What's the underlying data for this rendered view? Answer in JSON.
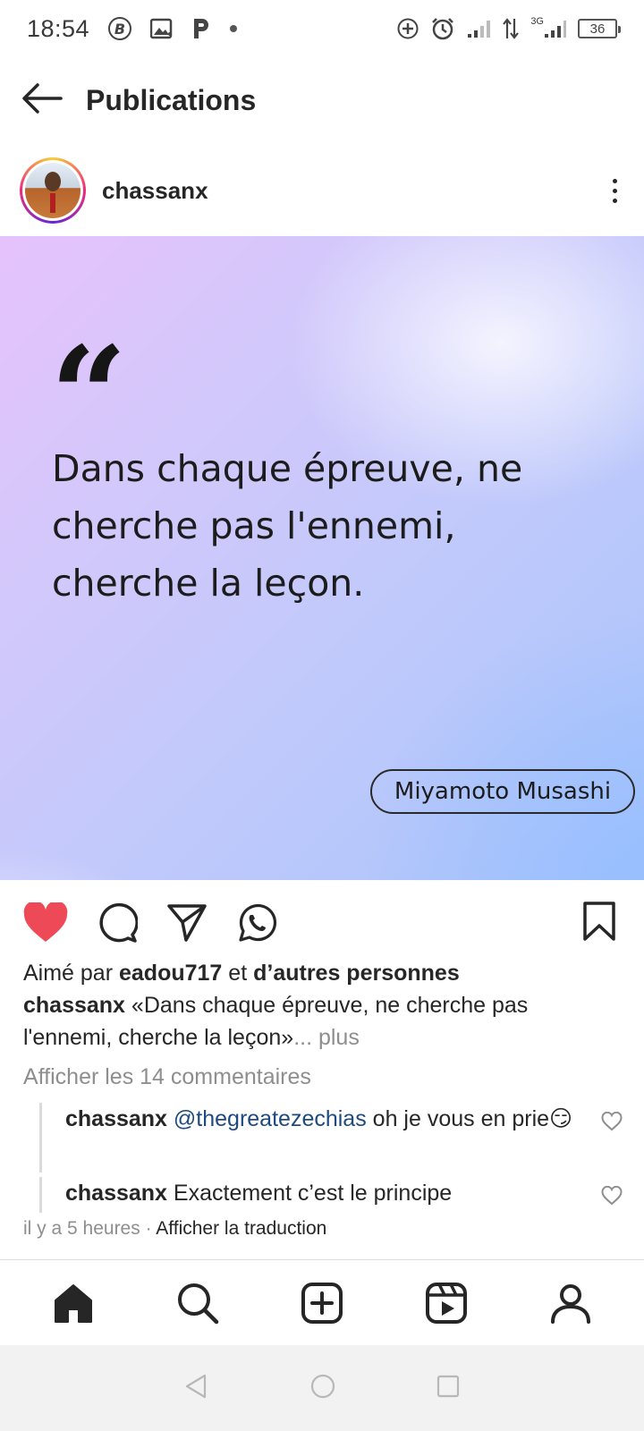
{
  "status_bar": {
    "time": "18:54",
    "network_label": "3G",
    "battery": "36"
  },
  "header": {
    "title": "Publications"
  },
  "post": {
    "username": "chassanx",
    "image": {
      "quote_mark": "“",
      "quote": "Dans chaque épreuve, ne cherche pas l'ennemi, cherche la leçon.",
      "author": "Miyamoto Musashi"
    },
    "likes": {
      "prefix": "Aimé par",
      "user": "eadou717",
      "middle": "et",
      "others": "d’autres personnes"
    },
    "caption": {
      "user": "chassanx",
      "text": "«Dans chaque épreuve, ne cherche pas l'ennemi, cherche la leçon»",
      "more": "... plus"
    },
    "view_comments": "Afficher les 14 commentaires",
    "comments": [
      {
        "user": "chassanx",
        "mention": "@thegreatezechias",
        "text": "oh je vous en prie",
        "emoji": "😏"
      },
      {
        "user": "chassanx",
        "mention": "",
        "text": "Exactement c’est le principe",
        "emoji": ""
      }
    ],
    "time_ago": "il y a 5 heures",
    "separator": "·",
    "translate": "Afficher la traduction"
  },
  "colors": {
    "like_red": "#ed4956",
    "text": "#262626",
    "muted": "#8e8e8e",
    "mention_blue": "#1e4a80"
  },
  "icons": {
    "header": [
      "back-arrow-icon"
    ],
    "actions": [
      "heart-filled-icon",
      "comment-icon",
      "share-icon",
      "whatsapp-icon",
      "bookmark-icon"
    ],
    "bottom_nav": [
      "home-icon",
      "search-icon",
      "create-icon",
      "reels-icon",
      "profile-icon"
    ],
    "system_nav": [
      "back-triangle-icon",
      "home-circle-icon",
      "recents-square-icon"
    ]
  }
}
